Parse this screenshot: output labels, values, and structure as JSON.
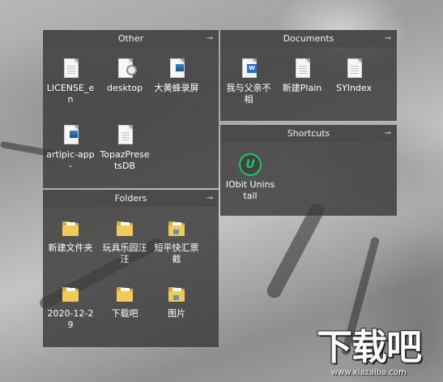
{
  "fences": {
    "other": {
      "title": "Other",
      "pin": "⊸",
      "items": [
        {
          "label": "LICENSE_en",
          "icon": "document-icon"
        },
        {
          "label": "desktop",
          "icon": "settings-document-icon"
        },
        {
          "label": "大黄蜂录屏",
          "icon": "app-shortcut-icon"
        },
        {
          "label": "artipic-app-",
          "icon": "app-shortcut-icon"
        },
        {
          "label": "TopazPresetsDB",
          "icon": "document-icon"
        }
      ]
    },
    "documents": {
      "title": "Documents",
      "pin": "⊸",
      "items": [
        {
          "label": "我与父亲不相",
          "icon": "word-document-icon"
        },
        {
          "label": "新建Plain",
          "icon": "document-icon"
        },
        {
          "label": "SYIndex",
          "icon": "document-icon"
        }
      ]
    },
    "shortcuts": {
      "title": "Shortcuts",
      "pin": "⊸",
      "items": [
        {
          "label": "IObit Uninstall",
          "icon": "iobit-icon",
          "glyph": "U"
        }
      ]
    },
    "folders": {
      "title": "Folders",
      "pin": "⊸",
      "items": [
        {
          "label": "新建文件夹",
          "icon": "folder-icon"
        },
        {
          "label": "玩具乐园汪汪",
          "icon": "folder-icon"
        },
        {
          "label": "短平快汇票截",
          "icon": "folder-icon"
        },
        {
          "label": "2020-12-29",
          "icon": "folder-icon"
        },
        {
          "label": "下载吧",
          "icon": "folder-icon"
        },
        {
          "label": "图片",
          "icon": "folder-icon"
        }
      ]
    }
  },
  "watermark": {
    "text": "下载吧",
    "url": "www.xiazaiba.com"
  },
  "colors": {
    "fence_bg": "#3a3a3a",
    "accent_green": "#1fc46a",
    "folder_yellow": "#f2ca58"
  }
}
